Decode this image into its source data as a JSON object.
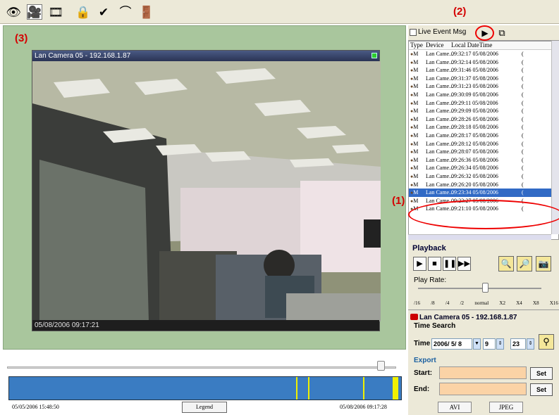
{
  "toolbar": {
    "buttons": [
      {
        "icon": "eye-icon",
        "glyph": "👁"
      },
      {
        "icon": "camera-hand-icon",
        "glyph": "🎥"
      },
      {
        "icon": "film-icon",
        "glyph": "🎞"
      },
      {
        "icon": "lock-icon",
        "glyph": "🔒"
      },
      {
        "icon": "check-tools-icon",
        "glyph": "✔"
      },
      {
        "icon": "arc-icon",
        "glyph": "⌒"
      },
      {
        "icon": "exit-icon",
        "glyph": "🚪"
      }
    ]
  },
  "callouts": {
    "one": "(1)",
    "two": "(2)",
    "three": "(3)"
  },
  "camera": {
    "title": "Lan Camera 05 - 192.168.1.87",
    "timestamp": "05/08/2006 09:17:21"
  },
  "timeline": {
    "start": "05/05/2006 15:48:50",
    "end": "05/08/2006 09:17:28",
    "legend_label": "Legend",
    "slider_position": 0.97,
    "markers": [
      0.73,
      0.76,
      0.9,
      0.975
    ]
  },
  "events": {
    "tab_label": "Live Event Msg",
    "columns": [
      "Type",
      "Device",
      "Local DateTime"
    ],
    "rows": [
      {
        "type": "M",
        "device": "Lan Came...",
        "datetime": "09:32:17 05/08/2006"
      },
      {
        "type": "M",
        "device": "Lan Came...",
        "datetime": "09:32:14 05/08/2006"
      },
      {
        "type": "M",
        "device": "Lan Came...",
        "datetime": "09:31:46 05/08/2006"
      },
      {
        "type": "M",
        "device": "Lan Came...",
        "datetime": "09:31:37 05/08/2006"
      },
      {
        "type": "M",
        "device": "Lan Came...",
        "datetime": "09:31:23 05/08/2006"
      },
      {
        "type": "M",
        "device": "Lan Came...",
        "datetime": "09:30:09 05/08/2006"
      },
      {
        "type": "M",
        "device": "Lan Came...",
        "datetime": "09:29:11 05/08/2006"
      },
      {
        "type": "M",
        "device": "Lan Came...",
        "datetime": "09:29:09 05/08/2006"
      },
      {
        "type": "M",
        "device": "Lan Came...",
        "datetime": "09:28:26 05/08/2006"
      },
      {
        "type": "M",
        "device": "Lan Came...",
        "datetime": "09:28:18 05/08/2006"
      },
      {
        "type": "M",
        "device": "Lan Came...",
        "datetime": "09:28:17 05/08/2006"
      },
      {
        "type": "M",
        "device": "Lan Came...",
        "datetime": "09:28:12 05/08/2006"
      },
      {
        "type": "M",
        "device": "Lan Came...",
        "datetime": "09:28:07 05/08/2006"
      },
      {
        "type": "M",
        "device": "Lan Came...",
        "datetime": "09:26:36 05/08/2006"
      },
      {
        "type": "M",
        "device": "Lan Came...",
        "datetime": "09:26:34 05/08/2006"
      },
      {
        "type": "M",
        "device": "Lan Came...",
        "datetime": "09:26:32 05/08/2006"
      },
      {
        "type": "M",
        "device": "Lan Came...",
        "datetime": "09:26:20 05/08/2006"
      },
      {
        "type": "M",
        "device": "Lan Came...",
        "datetime": "09:23:34 05/08/2006",
        "selected": true
      },
      {
        "type": "M",
        "device": "Lan Came...",
        "datetime": "09:23:27 05/08/2006"
      },
      {
        "type": "M",
        "device": "Lan Came...",
        "datetime": "09:21:10 05/08/2006"
      }
    ]
  },
  "playback": {
    "title": "Playback",
    "play_rate_label": "Play Rate:",
    "rates": [
      "/16",
      "/8",
      "/4",
      "/2",
      "normal",
      "X2",
      "X4",
      "X8",
      "X16"
    ],
    "rate_position": 0.55
  },
  "time_search": {
    "camera": "Lan Camera 05 - 192.168.1.87",
    "title": "Time Search",
    "time_label": "Time",
    "date": "2006/ 5/ 8",
    "hour": "9",
    "minute": "23",
    "export_label": "Export",
    "start_label": "Start:",
    "end_label": "End:",
    "set_label": "Set",
    "avi_label": "AVI",
    "jpeg_label": "JPEG"
  }
}
